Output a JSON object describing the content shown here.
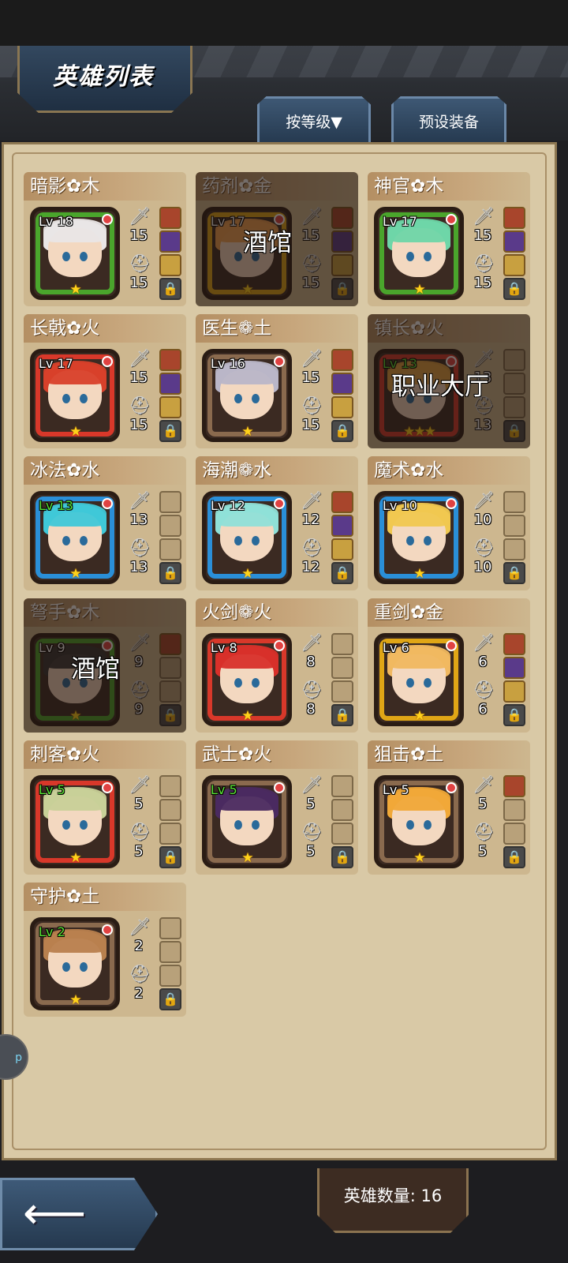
{
  "header": {
    "title": "英雄列表",
    "sort_button": "按等级▼",
    "preset_button": "预设装备"
  },
  "footer": {
    "hero_count": "英雄数量: 16"
  },
  "side_bubble": "p",
  "colors": {
    "panel": "#d9c9a6",
    "wood_frame": "#4aa52c",
    "fire_frame": "#d8382a",
    "water_frame": "#2a8fd8",
    "gold_frame": "#e0a616",
    "earth_frame": "#8a6a4e"
  },
  "heroes": [
    {
      "name": "暗影✿木",
      "lv": "Lv 18",
      "atk": "15",
      "def": "15",
      "stars": "★",
      "element": "wood",
      "lv_green": false,
      "dim": false,
      "label": "",
      "slots": 3,
      "hair": "#e9e6e6"
    },
    {
      "name": "药剂✿金",
      "lv": "Lv 17",
      "atk": "15",
      "def": "15",
      "stars": "★",
      "element": "gold",
      "lv_green": false,
      "dim": true,
      "label": "酒馆",
      "slots": 3,
      "hair": "#f0a050"
    },
    {
      "name": "神官✿木",
      "lv": "Lv 17",
      "atk": "15",
      "def": "15",
      "stars": "★",
      "element": "wood",
      "lv_green": false,
      "dim": false,
      "label": "",
      "slots": 3,
      "hair": "#6ed6a8"
    },
    {
      "name": "长戟✿火",
      "lv": "Lv 17",
      "atk": "15",
      "def": "15",
      "stars": "★",
      "element": "fire",
      "lv_green": false,
      "dim": false,
      "label": "",
      "slots": 3,
      "hair": "#d8402a"
    },
    {
      "name": "医生❁土",
      "lv": "Lv 16",
      "atk": "15",
      "def": "15",
      "stars": "★",
      "element": "earth",
      "lv_green": false,
      "dim": false,
      "label": "",
      "slots": 3,
      "hair": "#b9b6c8"
    },
    {
      "name": "镇长✿火",
      "lv": "Lv 13",
      "atk": "13",
      "def": "13",
      "stars": "★★★",
      "element": "fire",
      "lv_green": true,
      "dim": true,
      "label": "职业大厅",
      "slots": 0,
      "hair": "#e0a040"
    },
    {
      "name": "冰法✿水",
      "lv": "Lv 13",
      "atk": "13",
      "def": "13",
      "stars": "★",
      "element": "water",
      "lv_green": true,
      "dim": false,
      "label": "",
      "slots": 0,
      "hair": "#3fc8d8"
    },
    {
      "name": "海潮❁水",
      "lv": "Lv 12",
      "atk": "12",
      "def": "12",
      "stars": "★",
      "element": "water",
      "lv_green": false,
      "dim": false,
      "label": "",
      "slots": 3,
      "hair": "#8fe0d8"
    },
    {
      "name": "魔术✿水",
      "lv": "Lv 10",
      "atk": "10",
      "def": "10",
      "stars": "★",
      "element": "water",
      "lv_green": false,
      "dim": false,
      "label": "",
      "slots": 0,
      "hair": "#f0c850"
    },
    {
      "name": "弩手✿木",
      "lv": "Lv 9",
      "atk": "9",
      "def": "9",
      "stars": "★",
      "element": "wood",
      "lv_green": false,
      "dim": true,
      "label": "酒馆",
      "slots": 1,
      "hair": "#333333"
    },
    {
      "name": "火剑❁火",
      "lv": "Lv 8",
      "atk": "8",
      "def": "8",
      "stars": "★",
      "element": "fire",
      "lv_green": false,
      "dim": false,
      "label": "",
      "slots": 0,
      "hair": "#d8302a"
    },
    {
      "name": "重剑✿金",
      "lv": "Lv 6",
      "atk": "6",
      "def": "6",
      "stars": "★",
      "element": "gold",
      "lv_green": false,
      "dim": false,
      "label": "",
      "slots": 3,
      "hair": "#f0b860"
    },
    {
      "name": "刺客✿火",
      "lv": "Lv 5",
      "atk": "5",
      "def": "5",
      "stars": "★",
      "element": "fire",
      "lv_green": true,
      "dim": false,
      "label": "",
      "slots": 0,
      "hair": "#c8d098"
    },
    {
      "name": "武士✿火",
      "lv": "Lv 5",
      "atk": "5",
      "def": "5",
      "stars": "★",
      "element": "earth",
      "lv_green": true,
      "dim": false,
      "label": "",
      "slots": 0,
      "hair": "#4a2a60"
    },
    {
      "name": "狙击✿土",
      "lv": "Lv 5",
      "atk": "5",
      "def": "5",
      "stars": "★",
      "element": "earth",
      "lv_green": false,
      "dim": false,
      "label": "",
      "slots": 1,
      "hair": "#f0a838"
    },
    {
      "name": "守护✿土",
      "lv": "Lv 2",
      "atk": "2",
      "def": "2",
      "stars": "★",
      "element": "earth",
      "lv_green": true,
      "dim": false,
      "label": "",
      "slots": 0,
      "hair": "#b8804e"
    }
  ]
}
